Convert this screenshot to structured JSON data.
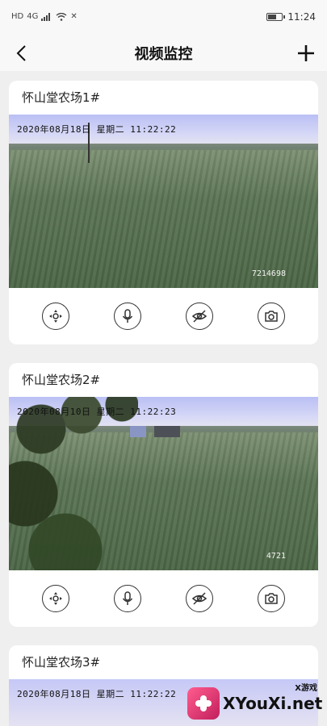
{
  "status_bar": {
    "left_text": "HD",
    "network": "4G",
    "time": "11:24"
  },
  "nav": {
    "title": "视频监控"
  },
  "cards": [
    {
      "title": "怀山堂农场1#",
      "timestamp": "2020年08月18日  星期二  11:22:22",
      "camera_id": "7214698"
    },
    {
      "title": "怀山堂农场2#",
      "timestamp": "2020年08月10日  星期二  11:22:23",
      "camera_id": "4721"
    },
    {
      "title": "怀山堂农场3#",
      "timestamp": "2020年08月18日  星期二  11:22:22",
      "camera_id": ""
    }
  ],
  "watermark": {
    "brand": "XYouXi.net",
    "tag": "X游戏",
    "brand_color": "#d8266b"
  },
  "icons": {
    "ptz": "ptz-direction-icon",
    "mic": "microphone-icon",
    "privacy": "eye-hidden-icon",
    "snapshot": "camera-icon"
  }
}
